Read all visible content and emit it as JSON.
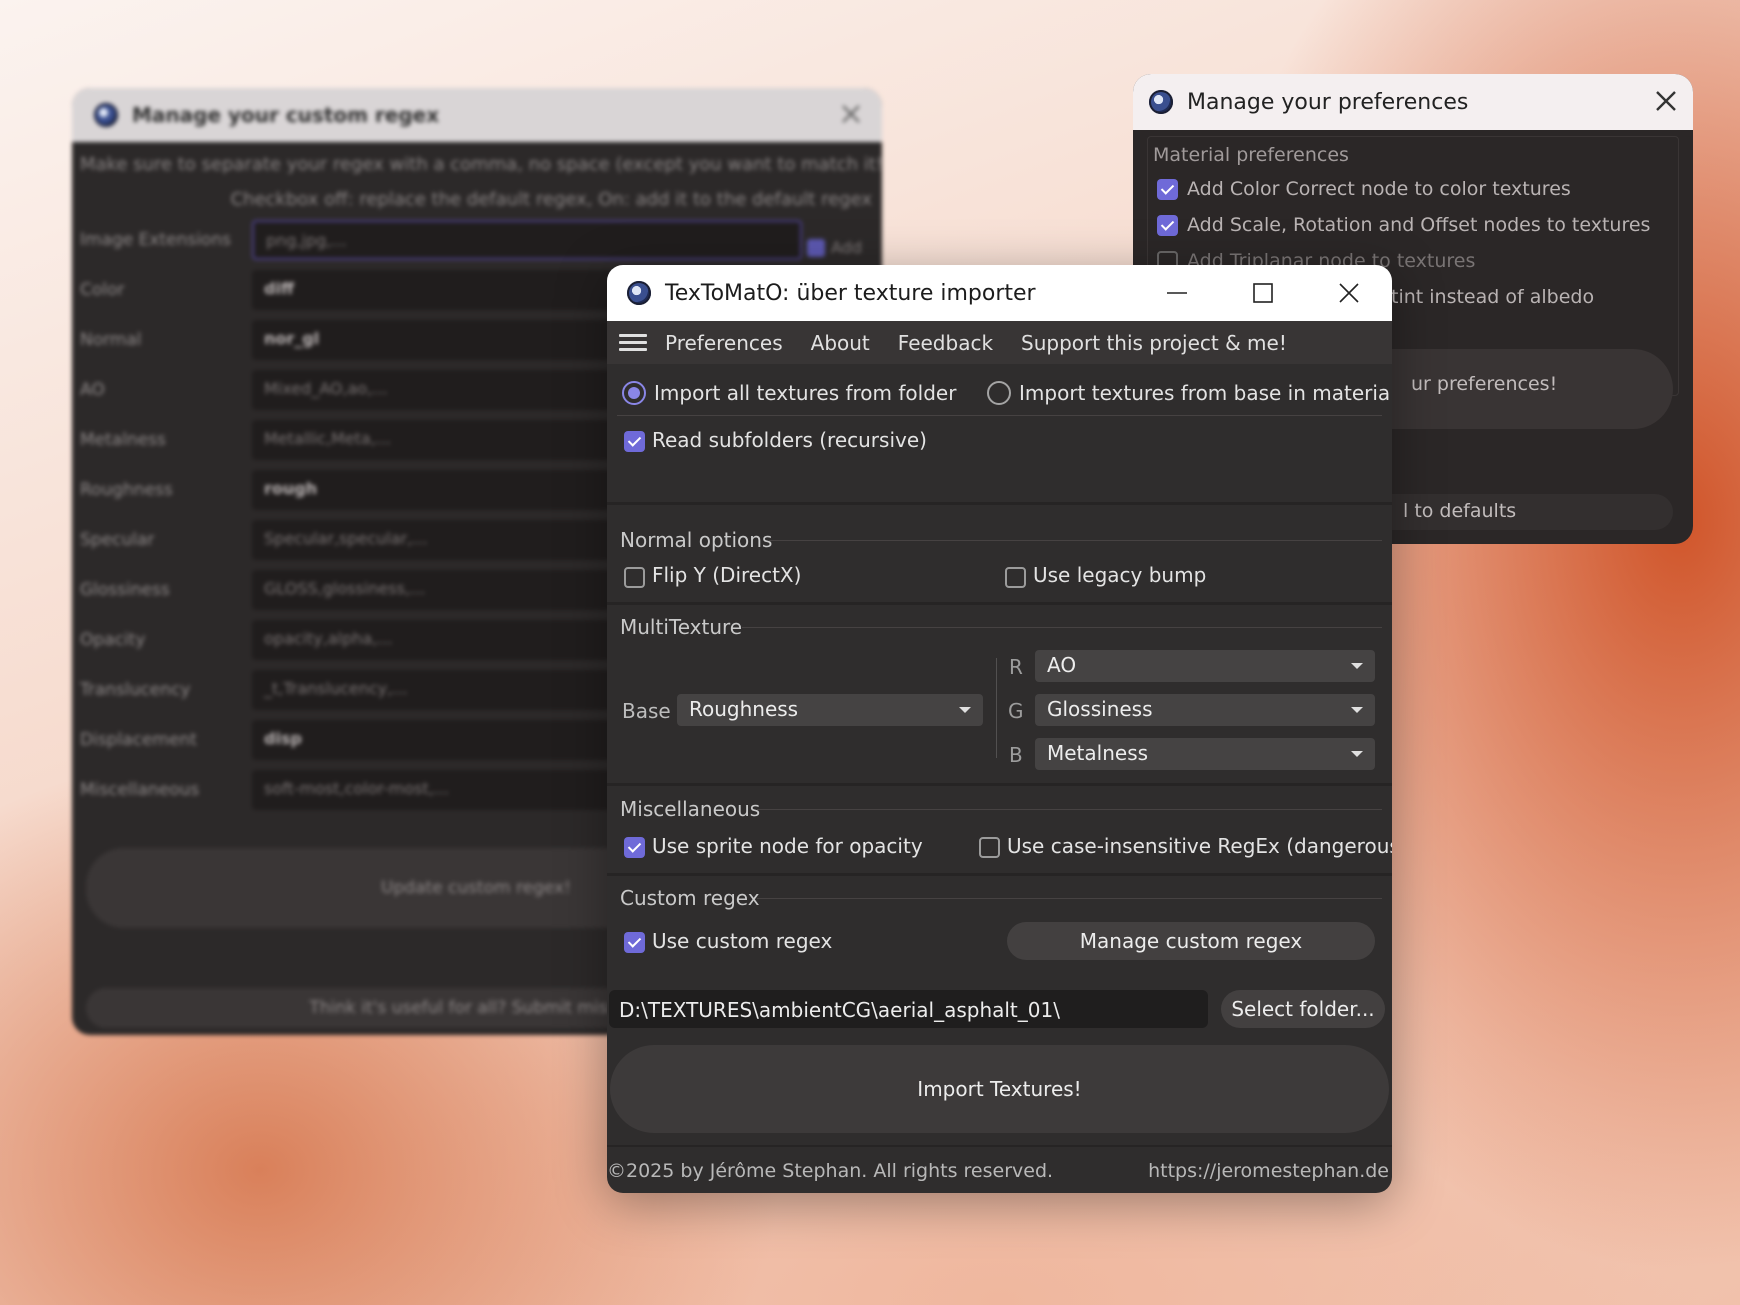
{
  "regex_window": {
    "title": "Manage your custom regex",
    "note_line1": "Make sure to separate your regex with a comma, no space (except you want to match it!)",
    "note_line2": "Checkbox off: replace the default regex, On: add it to the default regex",
    "add_label": "Add",
    "rows": [
      {
        "label": "Image Extensions",
        "value": "png,jpg,..."
      },
      {
        "label": "Color",
        "value": "diff"
      },
      {
        "label": "Normal",
        "value": "nor_gl"
      },
      {
        "label": "AO",
        "value": "Mixed_AO,ao,..."
      },
      {
        "label": "Metalness",
        "value": "Metallic,Meta,..."
      },
      {
        "label": "Roughness",
        "value": "rough"
      },
      {
        "label": "Specular",
        "value": "Specular,specular,..."
      },
      {
        "label": "Glossiness",
        "value": "GLOSS,glossiness,..."
      },
      {
        "label": "Opacity",
        "value": "opacity,alpha,..."
      },
      {
        "label": "Translucency",
        "value": "_t,Translucency,..."
      },
      {
        "label": "Displacement",
        "value": "disp"
      },
      {
        "label": "Miscellaneous",
        "value": "soft-most,color-most,..."
      }
    ],
    "update_button": "Update custom regex!",
    "submit_link": "Think it's useful for all? Submit missing"
  },
  "prefs_window": {
    "title": "Manage your preferences",
    "group_title": "Material preferences",
    "options": [
      {
        "label": "Add Color Correct node to color textures",
        "checked": true
      },
      {
        "label": "Add Scale, Rotation and Offset nodes to textures",
        "checked": true
      },
      {
        "label": "Add Triplanar node to textures",
        "checked": false
      },
      {
        "label": "tint instead of albedo",
        "checked": false
      }
    ],
    "save_button": "ur preferences!",
    "reset_button": "l to defaults"
  },
  "main_window": {
    "title": "TexToMatO: über texture importer",
    "menu": [
      "Preferences",
      "About",
      "Feedback",
      "Support this project & me!"
    ],
    "import_mode": {
      "option_folder": "Import all textures from folder",
      "option_base": "Import textures from base in material",
      "selected": "folder"
    },
    "read_subfolders": {
      "label": "Read subfolders (recursive)",
      "checked": true
    },
    "normal_options": {
      "title": "Normal options",
      "flip_y": {
        "label": "Flip Y (DirectX)",
        "checked": false
      },
      "legacy_bump": {
        "label": "Use legacy bump",
        "checked": false
      }
    },
    "multitexture": {
      "title": "MultiTexture",
      "base_label": "Base",
      "base_value": "Roughness",
      "r_label": "R",
      "r_value": "AO",
      "g_label": "G",
      "g_value": "Glossiness",
      "b_label": "B",
      "b_value": "Metalness"
    },
    "misc": {
      "title": "Miscellaneous",
      "sprite": {
        "label": "Use sprite node for opacity",
        "checked": true
      },
      "case_insensitive": {
        "label": "Use case-insensitive RegEx (dangerous!)",
        "checked": false
      }
    },
    "custom_regex": {
      "title": "Custom regex",
      "use": {
        "label": "Use custom regex",
        "checked": true
      },
      "manage_button": "Manage custom regex"
    },
    "folder_path": "D:\\TEXTURES\\ambientCG\\aerial_asphalt_01\\",
    "select_folder_button": "Select folder...",
    "import_button": "Import Textures!",
    "copyright": "©2025 by Jérôme Stephan. All rights reserved.",
    "website": "https://jeromestephan.de"
  },
  "colors": {
    "accent": "#6f6ad8",
    "window_bg": "#2f2d2d",
    "titlebar": "#ffffff"
  }
}
